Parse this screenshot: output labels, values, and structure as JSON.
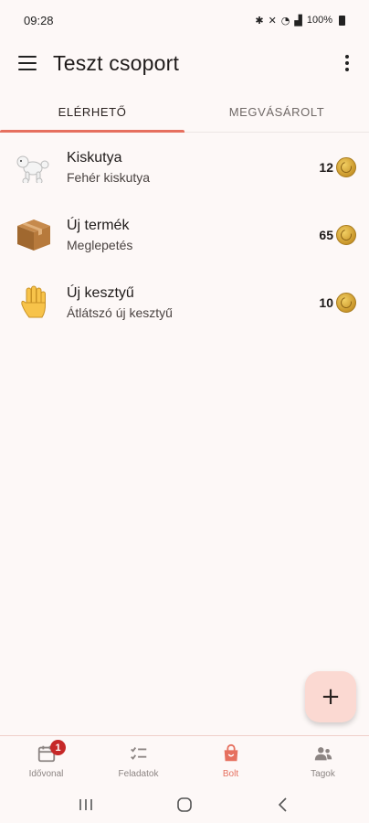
{
  "status_bar": {
    "time": "09:28",
    "battery": "100%",
    "icons": [
      "bluetooth-icon",
      "mute-icon",
      "wifi-icon",
      "signal-icon"
    ]
  },
  "app_bar": {
    "title": "Teszt csoport"
  },
  "tabs": [
    {
      "label": "ELÉRHETŐ",
      "active": true
    },
    {
      "label": "MEGVÁSÁROLT",
      "active": false
    }
  ],
  "items": [
    {
      "name": "Kiskutya",
      "description": "Fehér kiskutya",
      "price": "12",
      "icon": "poodle-icon"
    },
    {
      "name": "Új termék",
      "description": "Meglepetés",
      "price": "65",
      "icon": "package-icon"
    },
    {
      "name": "Új kesztyű",
      "description": "Átlátszó új kesztyű",
      "price": "10",
      "icon": "hand-icon"
    }
  ],
  "fab": {
    "label": "+"
  },
  "bottom_nav": [
    {
      "label": "Idővonal",
      "icon": "calendar-icon",
      "badge": "1",
      "active": false
    },
    {
      "label": "Feladatok",
      "icon": "checklist-icon",
      "active": false
    },
    {
      "label": "Bolt",
      "icon": "shopping-bag-icon",
      "active": true
    },
    {
      "label": "Tagok",
      "icon": "people-icon",
      "active": false
    }
  ],
  "colors": {
    "accent": "#e6705f",
    "background": "#fdf8f7",
    "fab_background": "#fbd9d2",
    "coin": "#d4a232",
    "badge": "#c62828"
  }
}
